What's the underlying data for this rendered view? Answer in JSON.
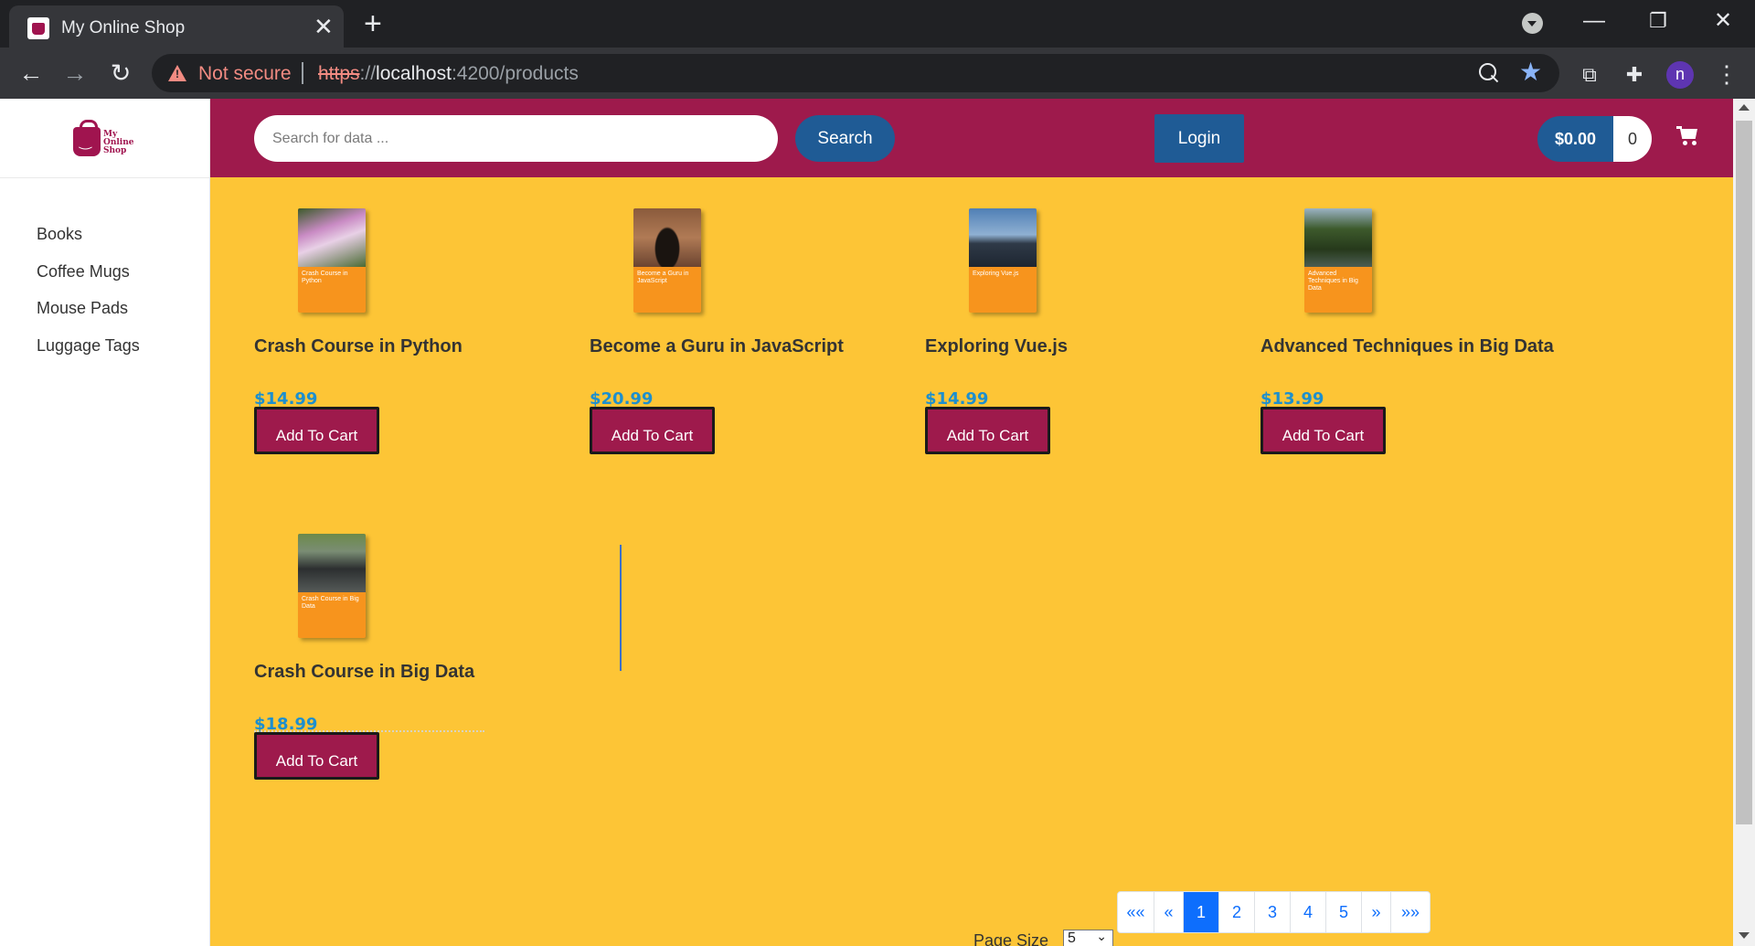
{
  "browser": {
    "tab_title": "My Online Shop",
    "tab_close": "✕",
    "new_tab": "+",
    "minimize": "—",
    "restore": "❐",
    "close": "✕",
    "back": "←",
    "forward": "→",
    "reload": "↻",
    "security_label": "Not secure",
    "url_scheme": "https",
    "url_sep": "://",
    "url_host": "localhost",
    "url_rest": ":4200/products",
    "profile_initial": "n",
    "menu": "⋮"
  },
  "shop": {
    "logo_text": "My Online Shop",
    "search_placeholder": "Search for data ...",
    "search_label": "Search",
    "login_label": "Login",
    "cart_total": "$0.00",
    "cart_count": "0"
  },
  "categories": [
    "Books",
    "Coffee Mugs",
    "Mouse Pads",
    "Luggage Tags"
  ],
  "products": [
    {
      "name": "Crash Course in Python",
      "price": "$14.99",
      "cover_title": "Crash Course in Python",
      "cover_photo": "flowers"
    },
    {
      "name": "Become a Guru in JavaScript",
      "price": "$20.99",
      "cover_title": "Become a Guru in JavaScript",
      "cover_photo": "archway"
    },
    {
      "name": "Exploring Vue.js",
      "price": "$14.99",
      "cover_title": "Exploring Vue.js",
      "cover_photo": "city-skyline"
    },
    {
      "name": "Advanced Techniques in Big Data",
      "price": "$13.99",
      "cover_title": "Advanced Techniques in Big Data",
      "cover_photo": "river-trees"
    },
    {
      "name": "Crash Course in Big Data",
      "price": "$18.99",
      "cover_title": "Crash Course in Big Data",
      "cover_photo": "ruins"
    }
  ],
  "add_to_cart_label": "Add To Cart",
  "pagination": {
    "first": "««",
    "prev": "«",
    "pages": [
      "1",
      "2",
      "3",
      "4",
      "5"
    ],
    "active_page": "1",
    "next": "»",
    "last": "»»",
    "page_size_label": "Page Size",
    "page_size_value": "5"
  },
  "colors": {
    "header": "#9e1a4c",
    "content_bg": "#fdc536",
    "accent_blue": "#1f5b95",
    "price_blue": "#1d8fce",
    "cover_orange": "#f7941d"
  }
}
